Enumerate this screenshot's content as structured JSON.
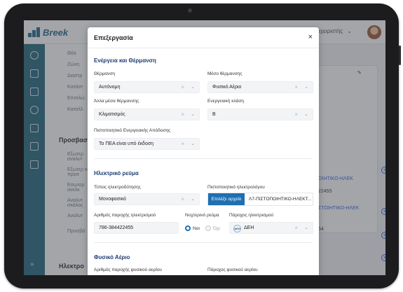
{
  "app": {
    "logo_text": "Breek",
    "header_user": "Διαχειριστής",
    "nav_items": [
      "Θέα",
      "Ζώνη",
      "Διαστρ",
      "Κατάστ",
      "Επιπλώ",
      "Καταλλ"
    ],
    "nav_section": "Προσβασ",
    "nav_items_2": [
      "Εξωτερ αναλυτ",
      "Εξωτερ και προσ",
      "Εσωτερ ανελκ",
      "Αναλυτ σκάλας",
      "Αναλυτ",
      "Προσβά"
    ],
    "nav_section_2": "Ηλεκτρο",
    "bg_right_text": [
      "ΟΙΗΤΙΚΟ-ΗΛΕΚ",
      "22455",
      "ΣΤΟΙΗΤΙΚΟ-ΗΛΕΚ",
      "54"
    ]
  },
  "modal": {
    "title": "Επεξεργασία",
    "close_icon": "×",
    "sections": {
      "energy": "Ενέργεια και Θέρμανση",
      "electric": "Ηλεκτρικό ρεύμα",
      "gas": "Φυσικό Αέριο"
    },
    "fields": {
      "heating_label": "Θέρμανση",
      "heating_value": "Αυτόνομη",
      "heating_medium_label": "Μέσο θέρμανσης",
      "heating_medium_value": "Φυσικό Αέριο",
      "other_heating_label": "Άλλα μέσα θέρμανσης",
      "other_heating_value": "Κλιματισμός",
      "energy_class_label": "Ενεργειακή κλάση",
      "energy_class_value": "B",
      "epc_label": "Πιστοποιητικό Ενεργειακής Απόδοσης",
      "epc_value": "Το ΠΕΑ είναι υπό έκδοση",
      "supply_type_label": "Τύπος ηλεκτροδότησης",
      "supply_type_value": "Μονοφασικό",
      "electrician_cert_label": "Πιστοποιητικό ηλεκτρολόγου",
      "choose_file_button": "Επιλέξε αρχείο",
      "file_name": "Λ7-ΠΙΣΤΟΠΟΙΗΤΙΚΟ-ΗΛΕΚΤ...",
      "meter_number_label": "Αριθμός παροχής ηλεκτρισμού",
      "meter_number_value": "786-384422455",
      "night_tariff_label": "Νυχτερινό ρεύμα",
      "night_yes": "Ναι",
      "night_no": "Όχι",
      "provider_label": "Πάροχος ηλεκτρισμού",
      "provider_value": "ΔΕΗ",
      "provider_logo_text": "ΔΕΗ",
      "gas_number_label": "Αριθμός παροχής φυσικού αερίου",
      "gas_provider_label": "Πάροχος φυσικού αερίου"
    },
    "select_clear_glyph": "×",
    "select_chevron_glyph": "⌄"
  },
  "colors": {
    "accent": "#1f6fb2",
    "section_title": "#1f3d73",
    "rail": "#2f6d82"
  }
}
